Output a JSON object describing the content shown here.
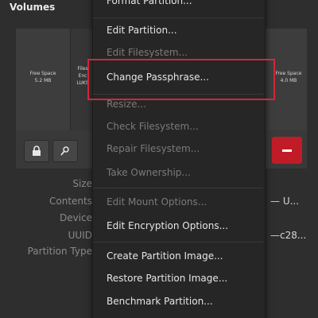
{
  "header": {
    "title": "Volumes"
  },
  "volumes": {
    "free_space_1": {
      "line1": "Free Space",
      "line2": "5.2 MB"
    },
    "partition": {
      "line1": "Files",
      "line2": "Enc",
      "line3": "LUKS"
    },
    "free_space_2": {
      "line1": "Free Space",
      "line2": "4.0 MB"
    }
  },
  "details": {
    "labels": [
      "Size",
      "Contents",
      "Device",
      "UUID",
      "Partition Type"
    ],
    "values": [
      "— U...",
      "",
      "",
      "—c28...",
      ""
    ]
  },
  "menu": {
    "items": [
      {
        "label": "Format Partition...",
        "enabled": true
      },
      {
        "label": "Edit Partition...",
        "enabled": true
      },
      {
        "label": "Edit Filesystem...",
        "enabled": false
      },
      {
        "label": "Change Passphrase...",
        "enabled": true
      },
      {
        "label": "Resize...",
        "enabled": false
      },
      {
        "label": "Check Filesystem...",
        "enabled": false
      },
      {
        "label": "Repair Filesystem...",
        "enabled": false
      },
      {
        "label": "Take Ownership...",
        "enabled": false
      },
      {
        "label": "Edit Mount Options...",
        "enabled": false
      },
      {
        "label": "Edit Encryption Options...",
        "enabled": true
      },
      {
        "label": "Create Partition Image...",
        "enabled": true
      },
      {
        "label": "Restore Partition Image...",
        "enabled": true
      },
      {
        "label": "Benchmark Partition...",
        "enabled": true
      }
    ]
  },
  "colors": {
    "background": "#2e2e2e",
    "menu_bg": "#262626",
    "delete_button": "#c01c28",
    "highlight_box": "#d4263a"
  }
}
